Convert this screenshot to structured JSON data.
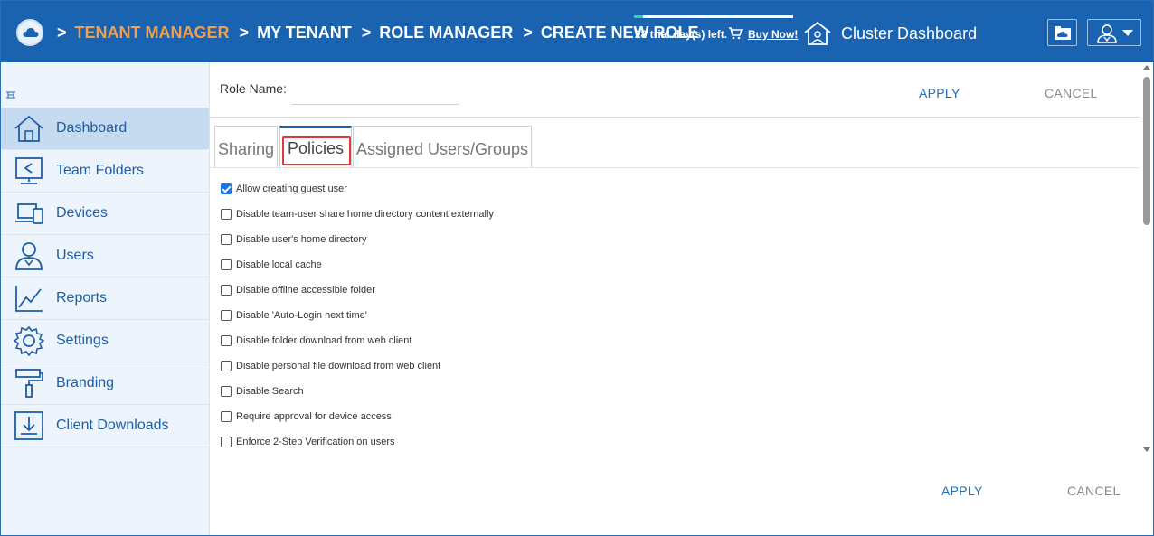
{
  "header": {
    "breadcrumbs": [
      {
        "label": "TENANT MANAGER",
        "color": "#f0a04b"
      },
      {
        "label": "MY TENANT",
        "color": "#ffffff"
      },
      {
        "label": "ROLE MANAGER",
        "color": "#ffffff"
      },
      {
        "label": "CREATE NEW ROLE",
        "color": "#ffffff"
      }
    ],
    "separator": ">",
    "trial_text": "28 trial day(s) left.",
    "buy_now": "Buy Now!",
    "cluster_dashboard": "Cluster Dashboard",
    "icons": [
      "cloud-logo-icon",
      "cart-icon",
      "cluster-home-icon",
      "cloud-folder-icon",
      "user-icon",
      "caret-down-icon"
    ]
  },
  "sidebar": {
    "collapse_icon": "collapse-icon",
    "items": [
      {
        "label": "Dashboard",
        "icon": "home-icon",
        "active": true
      },
      {
        "label": "Team Folders",
        "icon": "team-folder-icon",
        "active": false
      },
      {
        "label": "Devices",
        "icon": "devices-icon",
        "active": false
      },
      {
        "label": "Users",
        "icon": "users-icon",
        "active": false
      },
      {
        "label": "Reports",
        "icon": "reports-icon",
        "active": false
      },
      {
        "label": "Settings",
        "icon": "settings-icon",
        "active": false
      },
      {
        "label": "Branding",
        "icon": "branding-icon",
        "active": false
      },
      {
        "label": "Client Downloads",
        "icon": "client-downloads-icon",
        "active": false
      }
    ]
  },
  "form": {
    "role_name_label": "Role Name:",
    "role_name_value": "",
    "apply": "APPLY",
    "cancel": "CANCEL"
  },
  "tabs": [
    {
      "label": "Sharing",
      "active": false
    },
    {
      "label": "Policies",
      "active": true
    },
    {
      "label": "Assigned Users/Groups",
      "active": false
    }
  ],
  "policies": [
    {
      "label": "Allow creating guest user",
      "checked": true
    },
    {
      "label": "Disable team-user share home directory content externally",
      "checked": false
    },
    {
      "label": "Disable user's home directory",
      "checked": false
    },
    {
      "label": "Disable local cache",
      "checked": false
    },
    {
      "label": "Disable offline accessible folder",
      "checked": false
    },
    {
      "label": "Disable 'Auto-Login next time'",
      "checked": false
    },
    {
      "label": "Disable folder download from web client",
      "checked": false
    },
    {
      "label": "Disable personal file download from web client",
      "checked": false
    },
    {
      "label": "Disable Search",
      "checked": false
    },
    {
      "label": "Require approval for device access",
      "checked": false
    },
    {
      "label": "Enforce 2-Step Verification on users",
      "checked": false
    }
  ],
  "colors": {
    "header_bg": "#1a63b0",
    "accent": "#1d6fbf",
    "highlight_border": "#e0393e",
    "active_nav": "#c7dbf0"
  }
}
